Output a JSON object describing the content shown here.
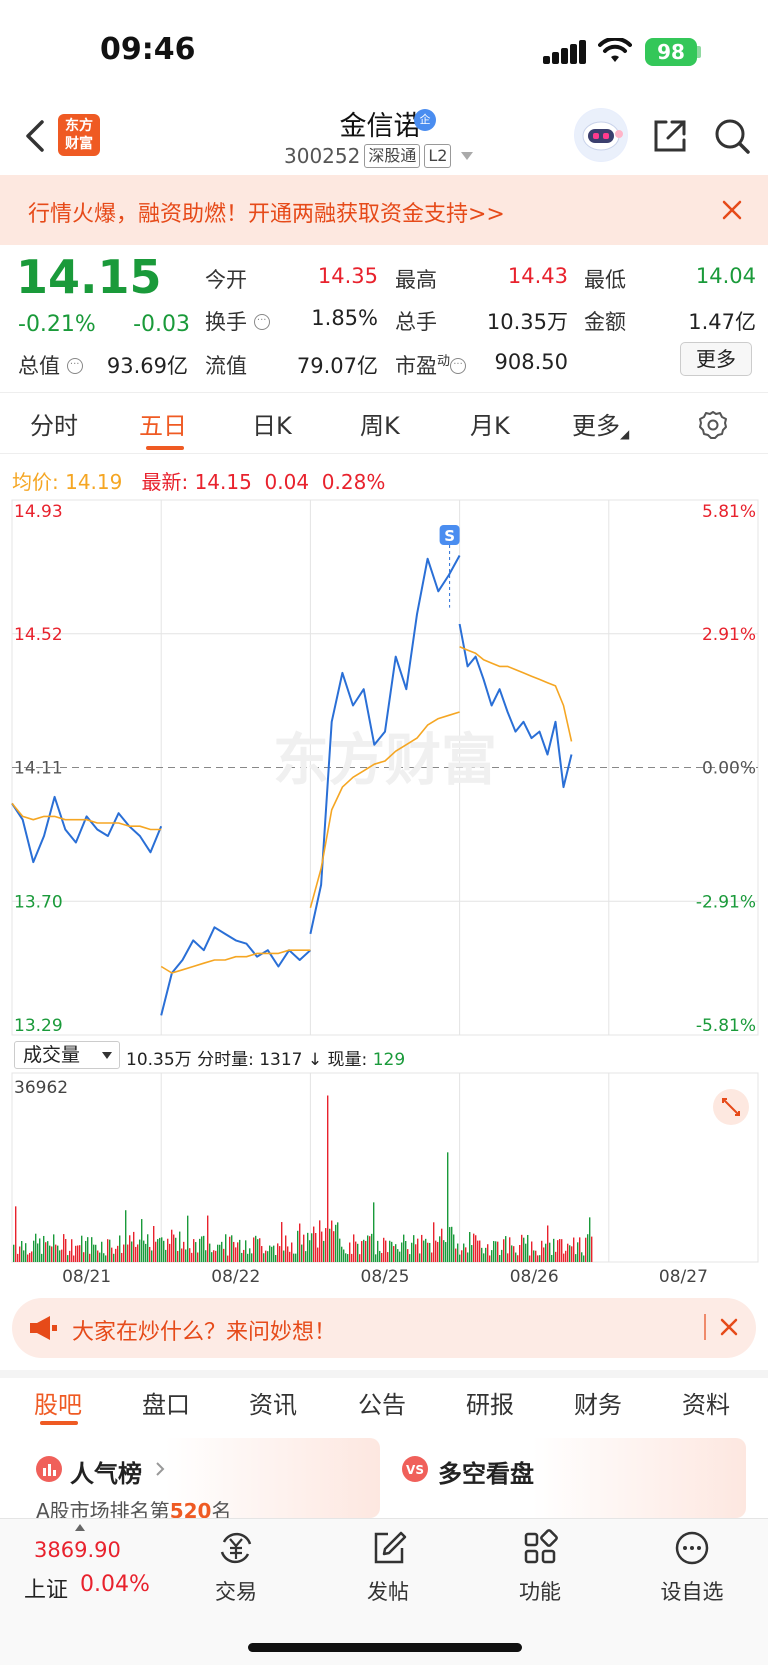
{
  "status_bar": {
    "time": "09:46",
    "battery": "98"
  },
  "header": {
    "logo_text": "东方财富",
    "stock_name": "金信诺",
    "badge": "企",
    "stock_code": "300252",
    "tag_connect": "深股通",
    "tag_level": "L2"
  },
  "promo": {
    "text": "行情火爆，融资助燃！开通两融获取资金支持>>"
  },
  "quote": {
    "price": "14.15",
    "change_pct": "-0.21%",
    "change_abs": "-0.03",
    "open_label": "今开",
    "open": "14.35",
    "high_label": "最高",
    "high": "14.43",
    "low_label": "最低",
    "low": "14.04",
    "turnover_label": "换手",
    "turnover": "1.85%",
    "volume_label": "总手",
    "volume": "10.35万",
    "amount_label": "金额",
    "amount": "1.47亿",
    "mktcap_label": "总值",
    "mktcap": "93.69亿",
    "float_label": "流值",
    "float_cap": "79.07亿",
    "pe_label": "市盈",
    "pe_sup": "动",
    "pe": "908.50",
    "more_label": "更多"
  },
  "period_tabs": [
    "分时",
    "五日",
    "日K",
    "周K",
    "月K",
    "更多"
  ],
  "chart_summary": {
    "avg_label": "均价:",
    "avg": "14.19",
    "latest_label": "最新:",
    "latest": "14.15",
    "latest_chg": "0.04",
    "latest_pct": "0.28%"
  },
  "chart_data": {
    "type": "line",
    "title": "",
    "y_labels_left": [
      "14.93",
      "14.52",
      "14.11",
      "13.70",
      "13.29"
    ],
    "y_labels_right": [
      "5.81%",
      "2.91%",
      "0.00%",
      "-2.91%",
      "-5.81%"
    ],
    "ylim": [
      13.29,
      14.93
    ],
    "prev_close": 14.11,
    "x_labels": [
      "08/21",
      "08/22",
      "08/25",
      "08/26",
      "08/27"
    ],
    "marker": "S",
    "watermark": "东方财富",
    "series": [
      {
        "name": "最新",
        "color": "#2a6fd6",
        "values": [
          [
            14.0,
            13.95,
            13.82,
            13.9,
            14.02,
            13.92,
            13.88,
            13.96,
            13.92,
            13.9,
            13.97,
            13.93,
            13.9,
            13.85,
            13.93
          ],
          [
            13.35,
            13.48,
            13.52,
            13.58,
            13.55,
            13.62,
            13.6,
            13.58,
            13.57,
            13.53,
            13.55,
            13.5,
            13.55,
            13.52,
            13.55
          ],
          [
            13.6,
            13.75,
            14.25,
            14.4,
            14.3,
            14.35,
            14.18,
            14.22,
            14.45,
            14.35,
            14.58,
            14.75,
            14.65,
            14.7,
            14.76
          ],
          [
            14.55,
            14.42,
            14.45,
            14.38,
            14.3,
            14.35,
            14.28,
            14.22,
            14.25,
            14.2,
            14.22,
            14.15,
            14.25,
            14.05,
            14.15
          ]
        ]
      },
      {
        "name": "均价",
        "color": "#f5a623",
        "values": [
          [
            14.0,
            13.96,
            13.95,
            13.96,
            13.96,
            13.95,
            13.95,
            13.95,
            13.94,
            13.94,
            13.94,
            13.93,
            13.93,
            13.92,
            13.92
          ],
          [
            13.5,
            13.48,
            13.49,
            13.5,
            13.51,
            13.52,
            13.52,
            13.53,
            13.53,
            13.54,
            13.54,
            13.54,
            13.55,
            13.55,
            13.55
          ],
          [
            13.68,
            13.8,
            13.98,
            14.05,
            14.08,
            14.1,
            14.12,
            14.13,
            14.16,
            14.18,
            14.2,
            14.24,
            14.26,
            14.27,
            14.28
          ],
          [
            14.48,
            14.47,
            14.46,
            14.44,
            14.43,
            14.42,
            14.42,
            14.41,
            14.4,
            14.39,
            14.38,
            14.37,
            14.36,
            14.3,
            14.19
          ]
        ]
      }
    ]
  },
  "volume_panel": {
    "selector": "成交量",
    "total": "10.35万",
    "tick_label": "分时量:",
    "tick_value": "1317",
    "arrow": "↓",
    "now_label": "现量:",
    "now_value": "129",
    "max_label": "36962"
  },
  "ai_banner": {
    "text": "大家在炒什么？来问妙想！"
  },
  "bottom_tabs": [
    "股吧",
    "盘口",
    "资讯",
    "公告",
    "研报",
    "财务",
    "资料"
  ],
  "cards": {
    "popularity_title": "人气榜",
    "popularity_sub_prefix": "A股市场排名第",
    "popularity_rank": "520",
    "popularity_sub_suffix": "名",
    "longshort_title": "多空看盘"
  },
  "bottom_nav": {
    "index_value": "3869.90",
    "index_name": "上证",
    "index_change": "0.04%",
    "items": [
      "交易",
      "发帖",
      "功能",
      "设自选"
    ]
  },
  "colors": {
    "up": "#e8222d",
    "down": "#1a9a3a",
    "accent": "#ef5a23",
    "line": "#2a6fd6",
    "avg": "#f5a623"
  }
}
